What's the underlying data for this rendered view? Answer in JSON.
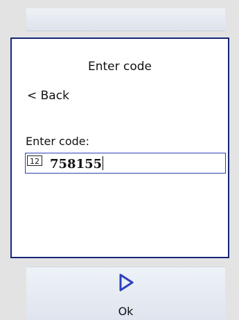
{
  "dialog": {
    "title": "Enter code",
    "back_label": "< Back",
    "field_label": "Enter code:",
    "input_mode": "12",
    "code_value": "758155"
  },
  "softkey": {
    "ok_label": "Ok",
    "icon": "play-triangle-icon"
  },
  "colors": {
    "accent": "#15257a",
    "input_border": "#2d3fb4",
    "background": "#e3e3e3"
  }
}
